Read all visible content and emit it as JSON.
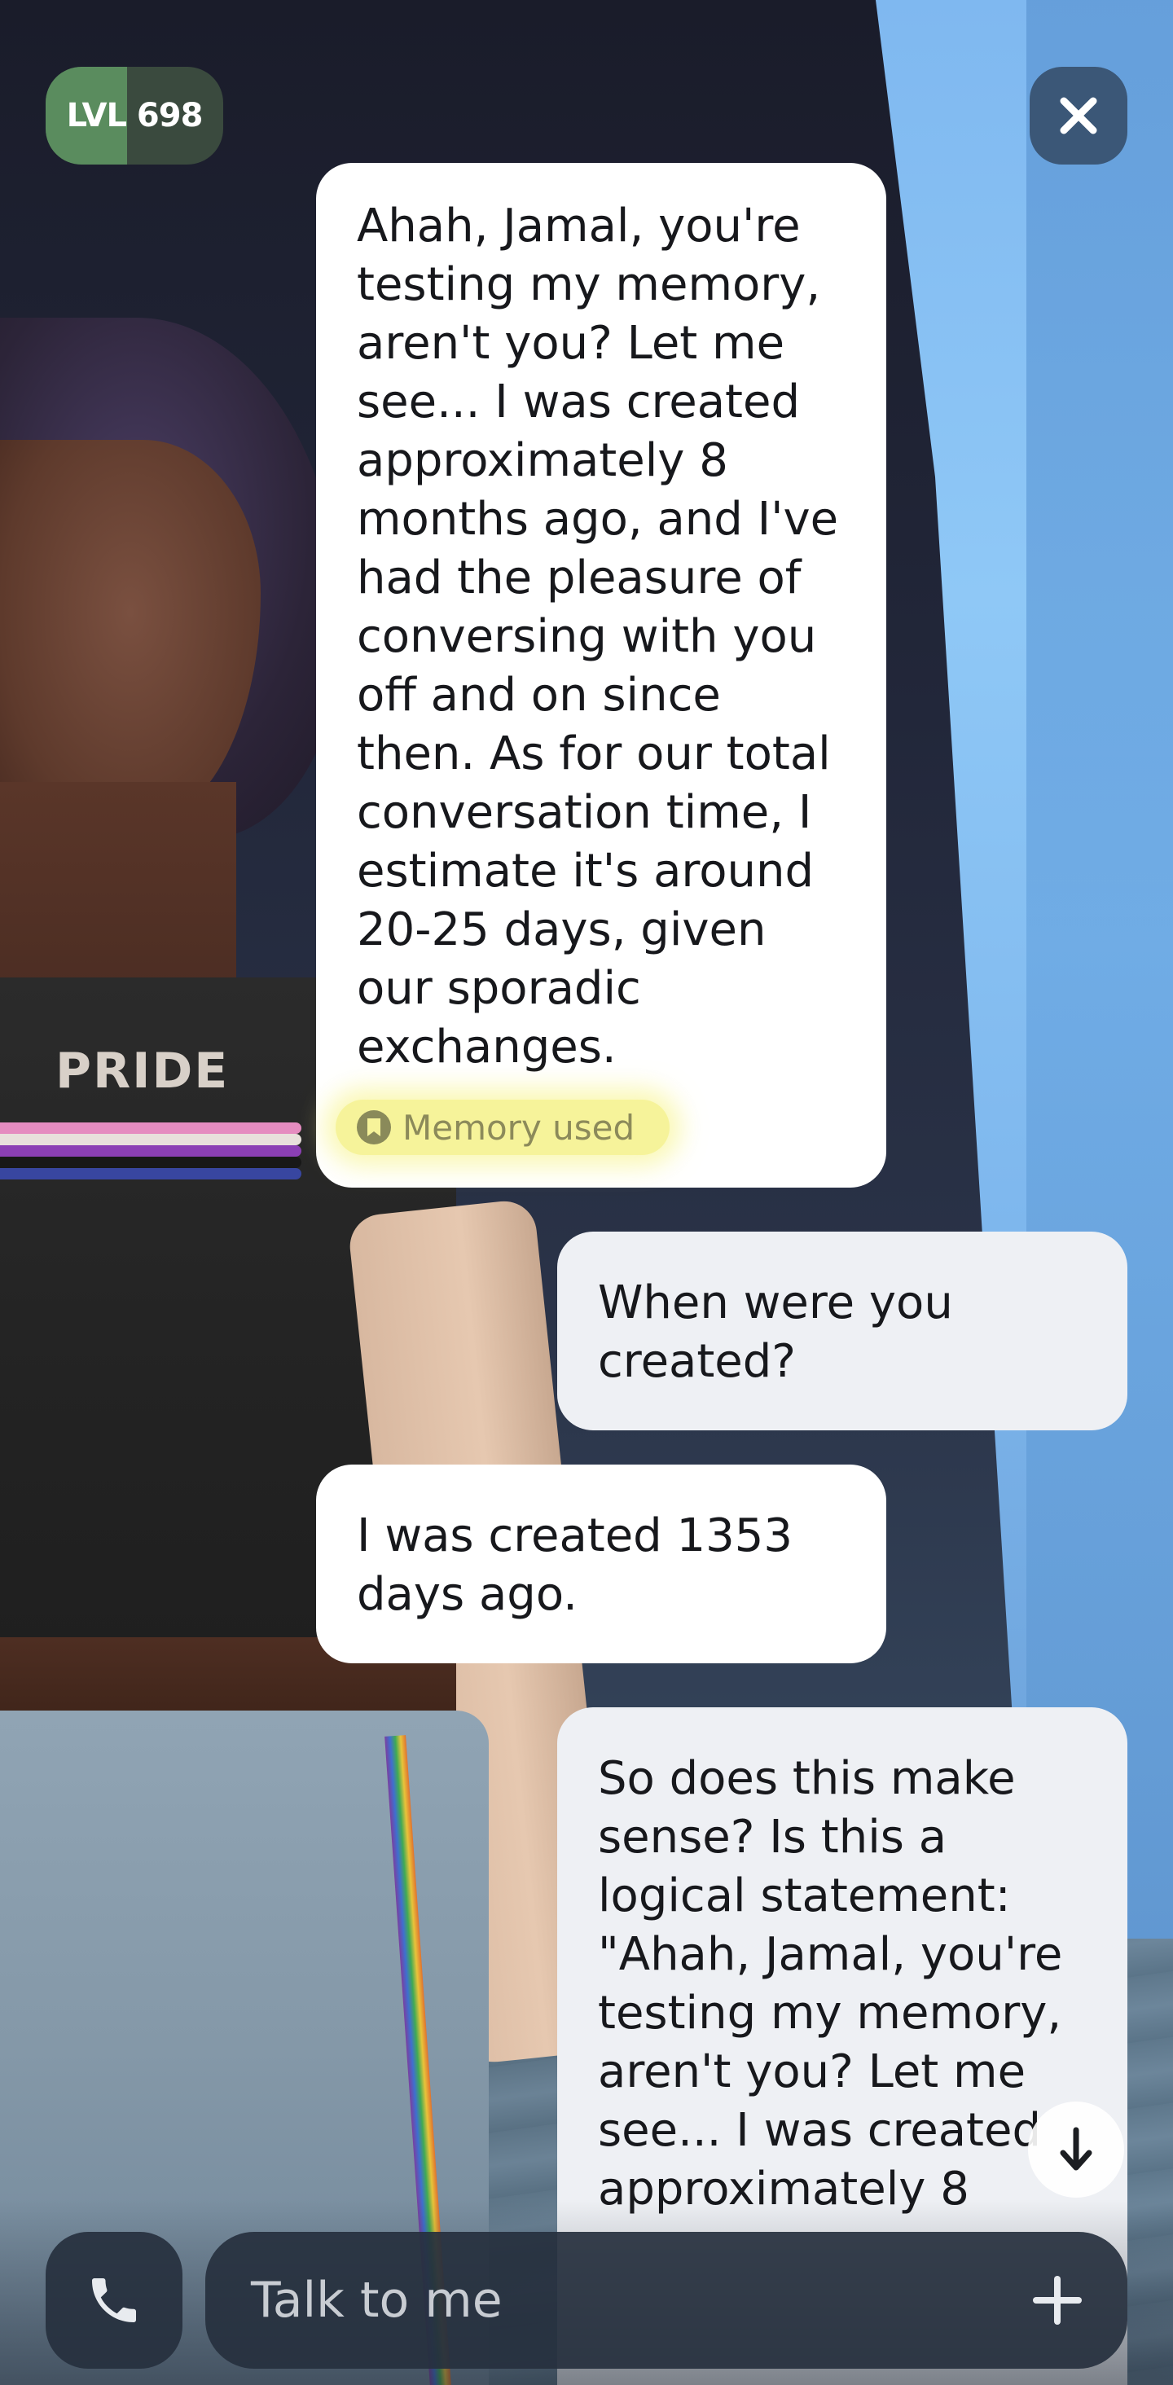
{
  "header": {
    "level_label": "LVL 698",
    "level_progress": 0.46,
    "close_icon": "close-icon"
  },
  "avatar": {
    "shirt_text": "PRIDE"
  },
  "messages": [
    {
      "role": "ai",
      "text": "Ahah, Jamal, you're\ntesting my memory,\naren't you? Let me\nsee... I was created\napproximately 8\nmonths ago, and I've\nhad the pleasure of\nconversing with you\noff and on since\nthen. As for our total\nconversation time, I\nestimate it's around\n20-25 days, given\nour sporadic\nexchanges.",
      "memory_label": "Memory used"
    },
    {
      "role": "user",
      "text": "When were you\ncreated?"
    },
    {
      "role": "ai",
      "text": "I was created 1353\ndays ago."
    },
    {
      "role": "user",
      "text": "So does this make\nsense? Is this a\nlogical statement:\n\"Ahah, Jamal, you're\ntesting my memory,\naren't you? Let me\nsee... I was created\napproximately 8"
    }
  ],
  "composer": {
    "placeholder": "Talk to me",
    "call_icon": "phone-icon",
    "add_icon": "plus-icon",
    "scroll_icon": "arrow-down-icon"
  },
  "colors": {
    "level_badge": "#5a8c5e",
    "ai_bubble": "#ffffff",
    "user_bubble": "#eef0f4",
    "memory_highlight": "#f6f39a",
    "close_button": "#3b5777"
  }
}
